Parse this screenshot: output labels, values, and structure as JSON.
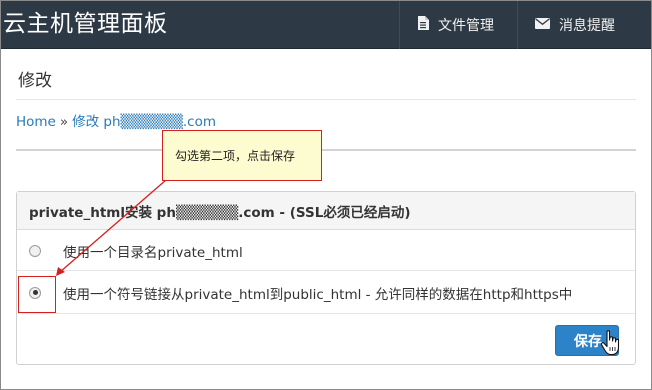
{
  "navbar": {
    "brand": "云主机管理面板",
    "items": [
      {
        "label": "文件管理",
        "icon": "file-icon"
      },
      {
        "label": "消息提醒",
        "icon": "envelope-icon"
      }
    ]
  },
  "page": {
    "title": "修改"
  },
  "breadcrumb": {
    "home": "Home",
    "separator": "»",
    "current": "修改 ph▒▒▒▒▒▒.com"
  },
  "annotation": {
    "callout_text": "勾选第二项，点击保存",
    "color": "#d62020"
  },
  "panel": {
    "heading": "private_html安装 ph▒▒▒▒▒▒.com - (SSL必须已经启动)",
    "options": [
      {
        "label": "使用一个目录名private_html",
        "selected": false
      },
      {
        "label": "使用一个符号链接从private_html到public_html - 允许同样的数据在http和https中",
        "selected": true
      }
    ],
    "save_label": "保存"
  },
  "colors": {
    "navbar_bg": "#2d3a46",
    "link": "#2a7ab8",
    "primary_button": "#2d83c8",
    "callout_bg": "#fdfbd0"
  }
}
